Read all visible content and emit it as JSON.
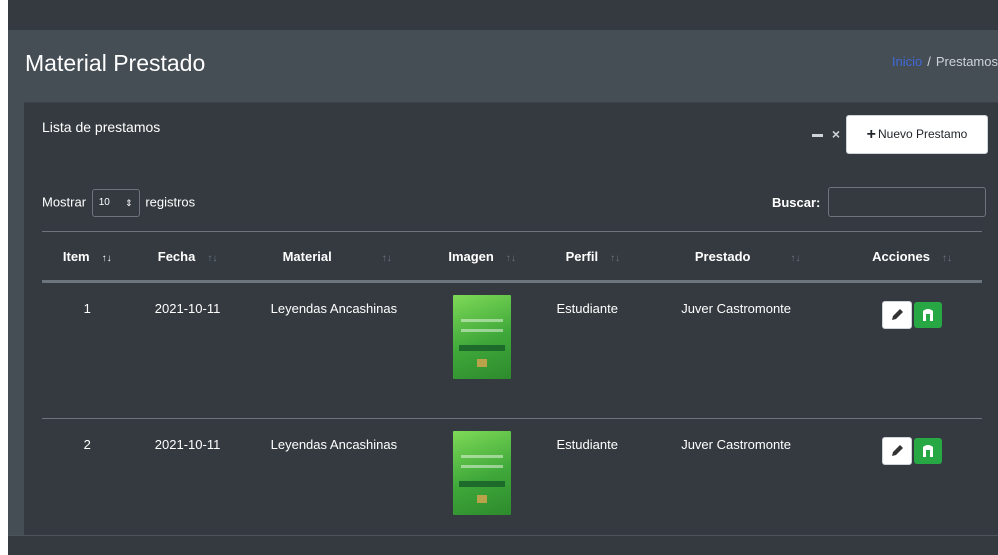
{
  "colors": {
    "navbar": "#343a40",
    "content_bg": "#454d55",
    "card_bg": "#343a40",
    "link": "#3f6ad8",
    "success": "#28a745",
    "primary": "#007bff"
  },
  "header": {
    "title": "Material Prestado",
    "breadcrumb": [
      {
        "label": "Inicio",
        "link": true
      },
      {
        "label": "Prestamos",
        "link": false
      }
    ]
  },
  "card": {
    "title": "Lista de prestamos",
    "new_button_label": "Nuevo Prestamo",
    "new_button_icon": "plus-icon",
    "minimize_icon": "minus-icon",
    "close_icon": "close-icon",
    "close_glyph": "×"
  },
  "table_controls": {
    "show_label": "Mostrar",
    "page_length": "10",
    "records_label": "registros",
    "search_label": "Buscar:",
    "search_value": ""
  },
  "table": {
    "columns": [
      "Item",
      "Fecha",
      "Material",
      "Imagen",
      "Perfil",
      "Prestado",
      "Acciones"
    ],
    "sorted_column": "Item",
    "rows": [
      {
        "item": "1",
        "fecha": "2021-10-11",
        "material": "Leyendas Ancashinas",
        "imagen": "book-cover-image",
        "perfil": "Estudiante",
        "prestado": "Juver Castromonte",
        "acciones": [
          "edit-icon",
          "return-icon"
        ]
      },
      {
        "item": "2",
        "fecha": "2021-10-11",
        "material": "Leyendas Ancashinas",
        "imagen": "book-cover-image",
        "perfil": "Estudiante",
        "prestado": "Juver Castromonte",
        "acciones": [
          "edit-icon",
          "return-icon"
        ]
      }
    ]
  }
}
